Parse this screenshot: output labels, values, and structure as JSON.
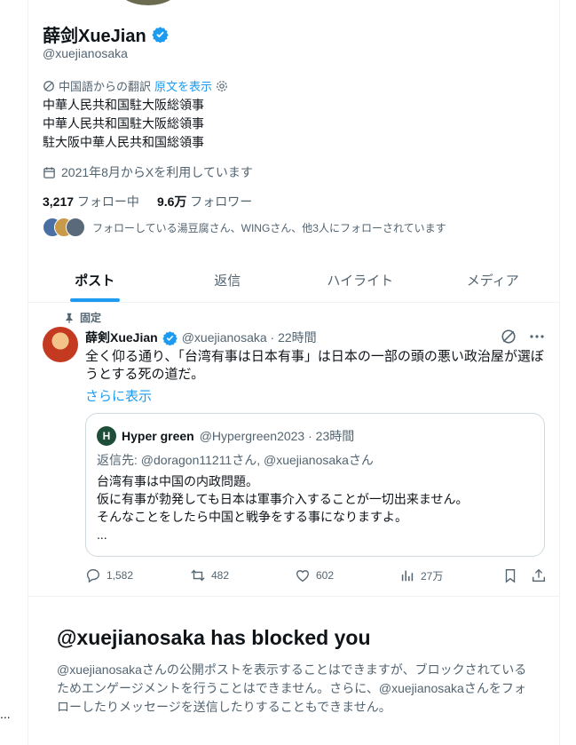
{
  "profile": {
    "name": "薛剑XueJian",
    "handle": "@xuejianosaka",
    "translation_note": "中国語からの翻訳",
    "show_original": "原文を表示",
    "bio_lines": [
      "中華人民共和国駐大阪総領事",
      "中華人民共和国駐大阪総領事",
      "駐大阪中華人民共和国総領事"
    ],
    "joined": "2021年8月からXを利用しています",
    "following_count": "3,217",
    "following_label": "フォロー中",
    "followers_count": "9.6万",
    "followers_label": "フォロワー",
    "followed_by": "フォローしている湯豆腐さん、WINGさん、他3人にフォローされています"
  },
  "tabs": [
    {
      "label": "ポスト"
    },
    {
      "label": "返信"
    },
    {
      "label": "ハイライト"
    },
    {
      "label": "メディア"
    }
  ],
  "post": {
    "pinned_label": "固定",
    "author": "薛剣XueJian",
    "handle_time": "@xuejianosaka · 22時間",
    "text": "全く仰る通り、「台湾有事は日本有事」は日本の一部の頭の悪い政治屋が選ぼうとする死の道だ。",
    "show_more": "さらに表示",
    "quote": {
      "avatar_letter": "H",
      "author": "Hyper green",
      "handle_time": "@Hypergreen2023 · 23時間",
      "reply_to": "返信先: @doragon11211さん, @xuejianosakaさん",
      "lines": [
        "台湾有事は中国の内政問題。",
        "仮に有事が勃発しても日本は軍事介入することが一切出来ません。",
        "そんなことをしたら中国と戦争をする事になりますよ。",
        "..."
      ]
    },
    "stats": {
      "replies": "1,582",
      "reposts": "482",
      "likes": "602",
      "views": "27万"
    }
  },
  "blocked": {
    "title": "@xuejianosaka has blocked you",
    "body": "@xuejianosakaさんの公開ポストを表示することはできますが、ブロックされているためエンゲージメントを行うことはできません。さらに、@xuejianosakaさんをフォローしたりメッセージを送信したりすることもできません。"
  },
  "left_edge_text": "..."
}
